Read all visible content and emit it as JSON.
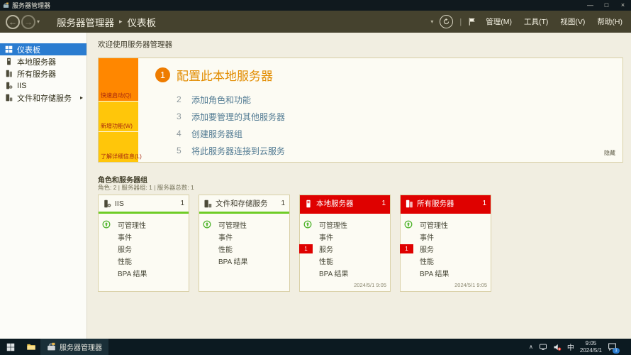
{
  "colors": {
    "accent_blue": "#2a7cd0",
    "navbar_olive": "#45422e",
    "quickstart_orange": "#ff8700",
    "strip_gold": "#ffc60a",
    "alert_red": "#df0100",
    "ok_green": "#6fcc26",
    "taskbar_dark": "#0c1a21"
  },
  "window": {
    "title": "服务器管理器",
    "minimize_glyph": "—",
    "maximize_glyph": "□",
    "close_glyph": "×"
  },
  "nav": {
    "breadcrumb_root": "服务器管理器",
    "breadcrumb_separator": "▸",
    "breadcrumb_current": "仪表板",
    "menus": [
      {
        "label": "管理(M)"
      },
      {
        "label": "工具(T)"
      },
      {
        "label": "视图(V)"
      },
      {
        "label": "帮助(H)"
      }
    ]
  },
  "sidebar": {
    "items": [
      {
        "label": "仪表板",
        "selected": true
      },
      {
        "label": "本地服务器"
      },
      {
        "label": "所有服务器"
      },
      {
        "label": "IIS"
      },
      {
        "label": "文件和存储服务",
        "expandable": true
      }
    ]
  },
  "main": {
    "greeting": "欢迎使用服务器管理器",
    "welcome_tile": {
      "strip": [
        {
          "label": "快速启动(Q)"
        },
        {
          "label": "新增功能(W)"
        },
        {
          "label": "了解详细信息(L)"
        }
      ],
      "primary_step": {
        "num": "1",
        "label": "配置此本地服务器"
      },
      "steps": [
        {
          "num": "2",
          "label": "添加角色和功能"
        },
        {
          "num": "3",
          "label": "添加要管理的其他服务器"
        },
        {
          "num": "4",
          "label": "创建服务器组"
        },
        {
          "num": "5",
          "label": "将此服务器连接到云服务"
        }
      ],
      "hide_label": "隐藏"
    },
    "roles_section": {
      "title": "角色和服务器组",
      "summary": "角色: 2 | 服务器组: 1 | 服务器总数: 1"
    },
    "tiles": [
      {
        "name": "IIS",
        "count": "1",
        "style": "green",
        "rows": [
          {
            "label": "可管理性",
            "status_icon": "up-circle"
          },
          {
            "label": "事件"
          },
          {
            "label": "服务"
          },
          {
            "label": "性能"
          },
          {
            "label": "BPA 结果"
          }
        ]
      },
      {
        "name": "文件和存储服务",
        "count": "1",
        "style": "green",
        "rows": [
          {
            "label": "可管理性",
            "status_icon": "up-circle"
          },
          {
            "label": "事件"
          },
          {
            "label": "性能"
          },
          {
            "label": "BPA 结果"
          }
        ]
      },
      {
        "name": "本地服务器",
        "count": "1",
        "style": "red",
        "rows": [
          {
            "label": "可管理性",
            "status_icon": "up-circle"
          },
          {
            "label": "事件"
          },
          {
            "label": "服务",
            "badge": "1"
          },
          {
            "label": "性能"
          },
          {
            "label": "BPA 结果"
          }
        ],
        "timestamp": "2024/5/1 9:05"
      },
      {
        "name": "所有服务器",
        "count": "1",
        "style": "red",
        "rows": [
          {
            "label": "可管理性",
            "status_icon": "up-circle"
          },
          {
            "label": "事件"
          },
          {
            "label": "服务",
            "badge": "1"
          },
          {
            "label": "性能"
          },
          {
            "label": "BPA 结果"
          }
        ],
        "timestamp": "2024/5/1 9:05"
      }
    ]
  },
  "taskbar": {
    "app_button_label": "服务器管理器",
    "tray": {
      "input_indicator": "中",
      "time": "9:05",
      "date": "2024/5/1",
      "notification_count": "1"
    }
  }
}
